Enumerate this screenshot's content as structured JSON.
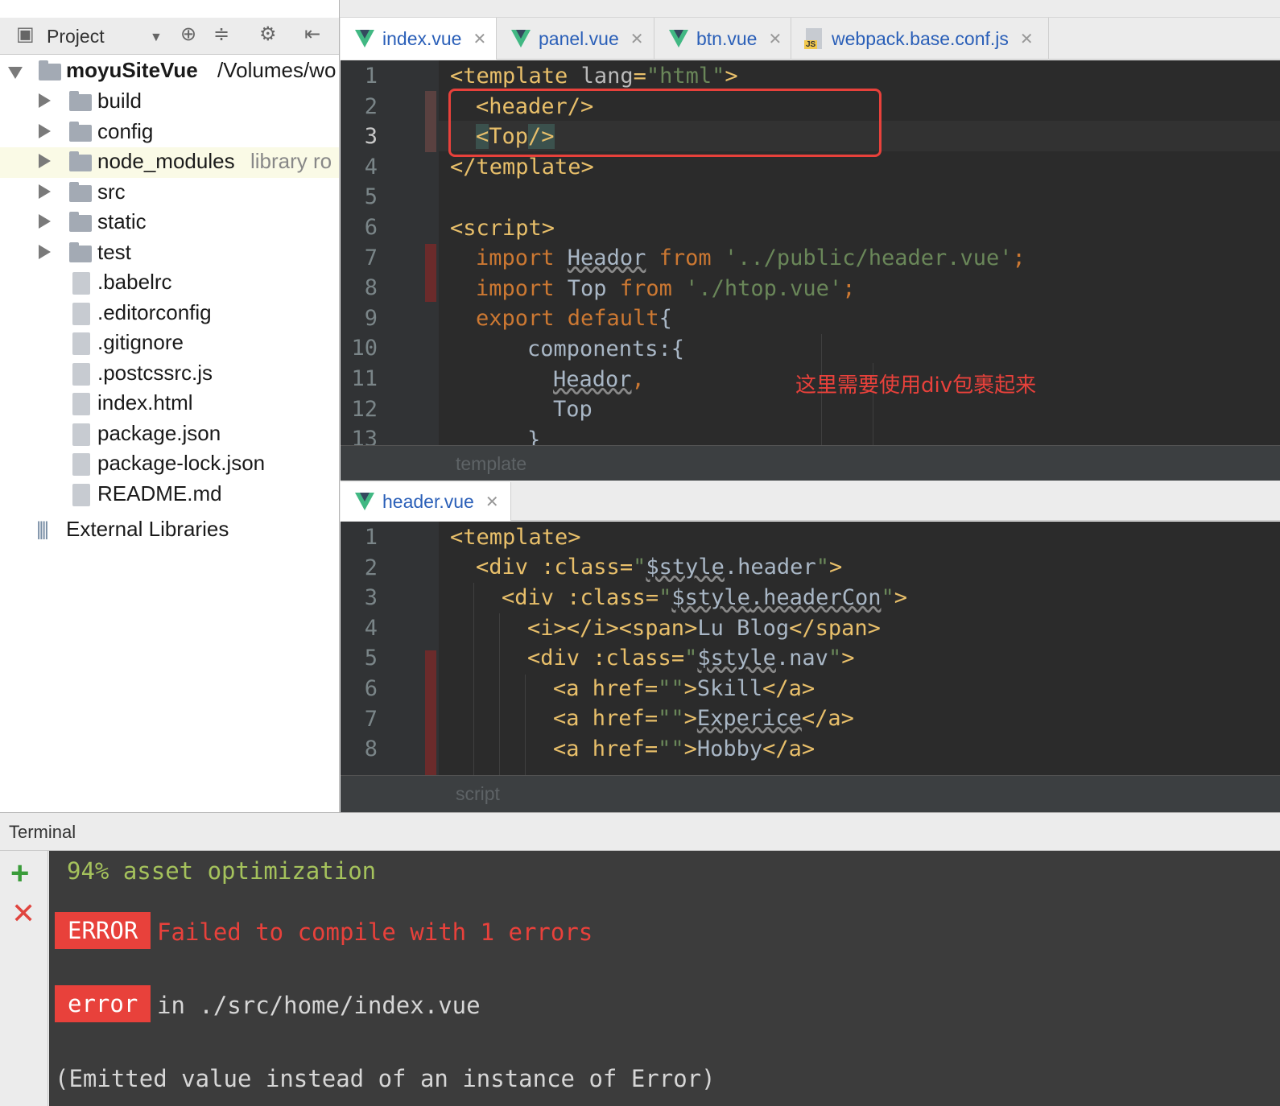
{
  "sidebar": {
    "toolbar": {
      "label": "Project"
    },
    "root": {
      "name": "moyuSiteVue",
      "path": "/Volumes/wo"
    },
    "items": [
      {
        "label": "build",
        "type": "folder"
      },
      {
        "label": "config",
        "type": "folder"
      },
      {
        "label": "node_modules",
        "type": "folder",
        "note": "library ro"
      },
      {
        "label": "src",
        "type": "folder"
      },
      {
        "label": "static",
        "type": "folder"
      },
      {
        "label": "test",
        "type": "folder"
      },
      {
        "label": ".babelrc",
        "type": "file"
      },
      {
        "label": ".editorconfig",
        "type": "file"
      },
      {
        "label": ".gitignore",
        "type": "file"
      },
      {
        "label": ".postcssrc.js",
        "type": "file"
      },
      {
        "label": "index.html",
        "type": "file"
      },
      {
        "label": "package.json",
        "type": "file"
      },
      {
        "label": "package-lock.json",
        "type": "file"
      },
      {
        "label": "README.md",
        "type": "file"
      }
    ],
    "external": "External Libraries"
  },
  "editor_top": {
    "tabs": [
      {
        "label": "index.vue"
      },
      {
        "label": "panel.vue"
      },
      {
        "label": "btn.vue"
      },
      {
        "label": "webpack.base.conf.js"
      }
    ],
    "line_numbers": [
      "1",
      "2",
      "3",
      "4",
      "5",
      "6",
      "7",
      "8",
      "9",
      "10",
      "11",
      "12",
      "13"
    ],
    "lines": {
      "l1": {
        "a": "<template ",
        "b": "lang",
        "c": "=",
        "d": "\"html\"",
        "e": ">"
      },
      "l2": "<header/>",
      "l3": {
        "a": "<",
        "b": "Top",
        "c": "/>"
      },
      "l4": "</template>",
      "l6": "<script>",
      "l7": {
        "a": "import ",
        "b": "Heador",
        "c": " from ",
        "d": "'../public/header.vue'",
        "e": ";"
      },
      "l8": {
        "a": "import ",
        "b": "Top",
        "c": " from ",
        "d": "'./htop.vue'",
        "e": ";"
      },
      "l9": {
        "a": "export default",
        "b": "{"
      },
      "l10": "components:{",
      "l11": {
        "a": "Heador",
        "b": ","
      },
      "l12": "Top",
      "l13": "}"
    },
    "breadcrumb": "template"
  },
  "annotation": {
    "note": "这里需要使用div包裹起来"
  },
  "editor_bottom": {
    "tab": "header.vue",
    "line_numbers": [
      "1",
      "2",
      "3",
      "4",
      "5",
      "6",
      "7",
      "8"
    ],
    "lines": {
      "l1": "<template>",
      "l2": {
        "a": "<div ",
        "b": ":class",
        "c": "=",
        "d": "\"",
        "e": "$style",
        "f": ".header",
        "g": "\"",
        "h": ">"
      },
      "l3": {
        "a": "<div ",
        "b": ":class",
        "c": "=",
        "d": "\"",
        "e": "$style",
        "f": ".headerCon",
        "g": "\"",
        "h": ">"
      },
      "l4": {
        "a": "<i></i><span>",
        "b": "Lu Blog",
        "c": "</span>"
      },
      "l5": {
        "a": "<div ",
        "b": ":class",
        "c": "=",
        "d": "\"",
        "e": "$style",
        "f": ".nav",
        "g": "\"",
        "h": ">"
      },
      "l6": {
        "a": "<a ",
        "b": "href",
        "c": "=",
        "d": "\"\"",
        "e": ">",
        "f": "Skill",
        "g": "</a>"
      },
      "l7": {
        "a": "<a ",
        "b": "href",
        "c": "=",
        "d": "\"\"",
        "e": ">",
        "f": "Experice",
        "g": "</a>"
      },
      "l8": {
        "a": "<a ",
        "b": "href",
        "c": "=",
        "d": "\"\"",
        "e": ">",
        "f": "Hobby",
        "g": "</a>"
      }
    },
    "breadcrumb": "script"
  },
  "terminal": {
    "title": "Terminal",
    "line1": "94% asset optimization",
    "error_badge": "ERROR",
    "error_msg": "Failed to compile with 1 errors",
    "error_badge2": "error",
    "error_loc": "in ./src/home/index.vue",
    "emitted": "(Emitted value instead of an instance of Error)"
  },
  "colors": {
    "accent_red": "#e8413b",
    "vue_green": "#41b883",
    "editor_bg": "#2b2b2b",
    "terminal_bg": "#3c3c3c"
  }
}
